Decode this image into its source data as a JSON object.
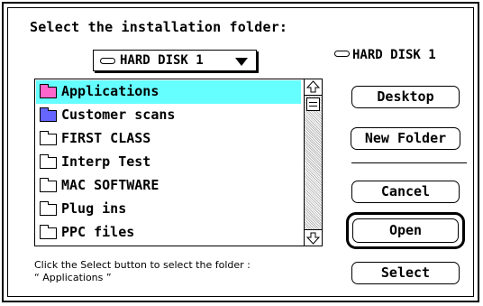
{
  "dialog": {
    "prompt": "Select the installation folder:",
    "popup_label": "HARD DISK 1",
    "volume_label": "HARD DISK 1"
  },
  "file_list": {
    "items": [
      {
        "name": "Applications",
        "icon": "folder-pink-icon",
        "selected": true
      },
      {
        "name": "Customer scans",
        "icon": "folder-blue-icon",
        "selected": false
      },
      {
        "name": "FIRST CLASS",
        "icon": "folder-icon",
        "selected": false
      },
      {
        "name": "Interp Test",
        "icon": "folder-icon",
        "selected": false
      },
      {
        "name": "MAC SOFTWARE",
        "icon": "folder-icon",
        "selected": false
      },
      {
        "name": "Plug ins",
        "icon": "folder-icon",
        "selected": false
      },
      {
        "name": "PPC files",
        "icon": "folder-icon",
        "selected": false
      }
    ],
    "selection_color": "#66ffff"
  },
  "buttons": {
    "desktop": "Desktop",
    "new_folder": "New Folder",
    "cancel": "Cancel",
    "open": "Open",
    "select": "Select"
  },
  "note": {
    "line1": "Click the Select button to select the folder :",
    "line2": "“ Applications ”"
  }
}
